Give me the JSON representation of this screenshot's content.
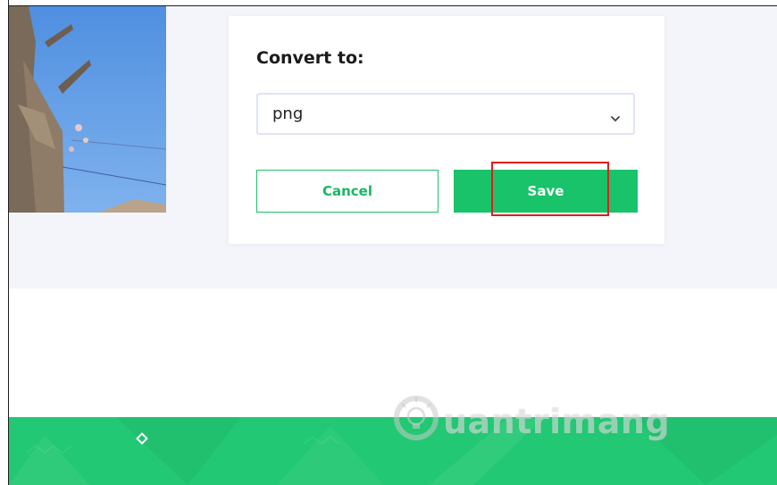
{
  "dialog": {
    "title": "Convert to:",
    "format_select": {
      "value": "png"
    },
    "cancel_label": "Cancel",
    "save_label": "Save"
  },
  "watermark": {
    "text": "uantrimang"
  },
  "icons": {
    "select_chevron": "chevron-down-icon",
    "footer_mark": "diamond-icon",
    "watermark_logo": "lightbulb-logo-icon"
  },
  "colors": {
    "accent_green": "#18c36a",
    "footer_green": "#22c873",
    "page_gray": "#f4f5fa",
    "highlight_red": "#e01e1e",
    "select_border": "#dfe3f6"
  }
}
